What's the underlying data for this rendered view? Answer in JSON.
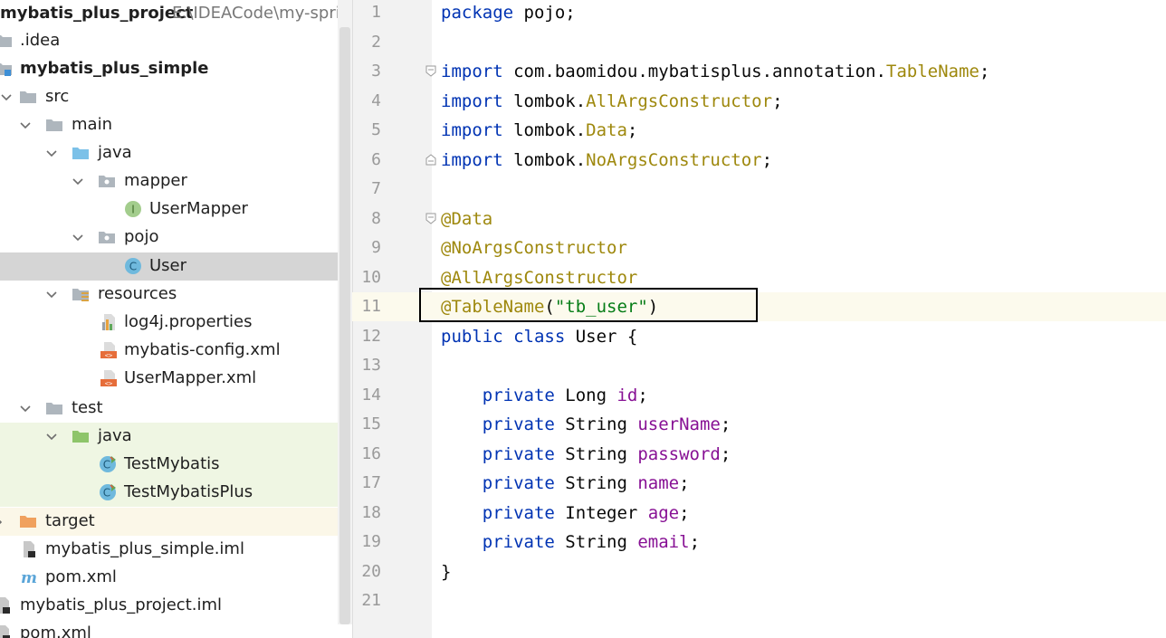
{
  "project_tree": {
    "items": [
      {
        "label": "mybatis_plus_project",
        "path": "E:\\IDEACode\\my-spring",
        "icon": "module-folder-icon",
        "bold": true
      },
      {
        "label": ".idea",
        "icon": "folder-icon"
      },
      {
        "label": "mybatis_plus_simple",
        "icon": "module-folder-icon",
        "bold": true
      },
      {
        "label": "src",
        "icon": "folder-icon"
      },
      {
        "label": "main",
        "icon": "folder-icon"
      },
      {
        "label": "java",
        "icon": "source-root-folder-icon"
      },
      {
        "label": "mapper",
        "icon": "package-icon"
      },
      {
        "label": "UserMapper",
        "icon": "interface-icon"
      },
      {
        "label": "pojo",
        "icon": "package-icon"
      },
      {
        "label": "User",
        "icon": "class-icon",
        "selected": true
      },
      {
        "label": "resources",
        "icon": "resources-folder-icon"
      },
      {
        "label": "log4j.properties",
        "icon": "properties-file-icon"
      },
      {
        "label": "mybatis-config.xml",
        "icon": "xml-file-icon"
      },
      {
        "label": "UserMapper.xml",
        "icon": "xml-file-icon"
      },
      {
        "label": "test",
        "icon": "folder-icon"
      },
      {
        "label": "java",
        "icon": "test-root-folder-icon"
      },
      {
        "label": "TestMybatis",
        "icon": "test-class-icon"
      },
      {
        "label": "TestMybatisPlus",
        "icon": "test-class-icon"
      },
      {
        "label": "target",
        "icon": "excluded-folder-icon"
      },
      {
        "label": "mybatis_plus_simple.iml",
        "icon": "iml-file-icon"
      },
      {
        "label": "pom.xml",
        "icon": "maven-file-icon"
      },
      {
        "label": "mybatis_plus_project.iml",
        "icon": "iml-file-icon"
      },
      {
        "label": "pom.xml",
        "icon": "maven-file-icon"
      }
    ]
  },
  "editor": {
    "line_numbers": [
      "1",
      "2",
      "3",
      "4",
      "5",
      "6",
      "7",
      "8",
      "9",
      "10",
      "11",
      "12",
      "13",
      "14",
      "15",
      "16",
      "17",
      "18",
      "19",
      "20",
      "21"
    ],
    "code": {
      "l1": [
        "package",
        " pojo;"
      ],
      "l3": [
        "import",
        " com.baomidou.mybatisplus.annotation.",
        "TableName",
        ";"
      ],
      "l4": [
        "import",
        " lombok.",
        "AllArgsConstructor",
        ";"
      ],
      "l5": [
        "import",
        " lombok.",
        "Data",
        ";"
      ],
      "l6": [
        "import",
        " lombok.",
        "NoArgsConstructor",
        ";"
      ],
      "l8": [
        "@Data"
      ],
      "l9": [
        "@NoArgsConstructor"
      ],
      "l10": [
        "@AllArgsConstructor"
      ],
      "l11": [
        "@TableName",
        "(",
        "\"tb_user\"",
        ")"
      ],
      "l12": [
        "public class",
        " User {"
      ],
      "l14": [
        "    ",
        "private",
        " Long ",
        "id",
        ";"
      ],
      "l15": [
        "    ",
        "private",
        " String ",
        "userName",
        ";"
      ],
      "l16": [
        "    ",
        "private",
        " String ",
        "password",
        ";"
      ],
      "l17": [
        "    ",
        "private",
        " String ",
        "name",
        ";"
      ],
      "l18": [
        "    ",
        "private",
        " Integer ",
        "age",
        ";"
      ],
      "l19": [
        "    ",
        "private",
        " String ",
        "email",
        ";"
      ],
      "l20": [
        "}"
      ]
    },
    "colors": {
      "keyword": "#0033b3",
      "annotation": "#9e880d",
      "field": "#871094",
      "string": "#067d17"
    }
  }
}
